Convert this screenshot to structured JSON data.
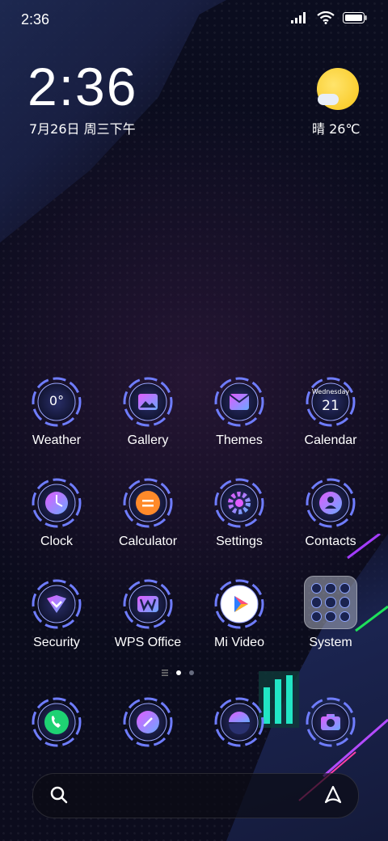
{
  "status_bar": {
    "time": "2:36"
  },
  "lockscreen_widget": {
    "clock": "2:36",
    "date": "7月26日 周三下午",
    "weather": "晴 26℃"
  },
  "apps": [
    {
      "label": "Weather",
      "icon": "weather-icon",
      "text": "0°"
    },
    {
      "label": "Gallery",
      "icon": "gallery-icon"
    },
    {
      "label": "Themes",
      "icon": "themes-icon"
    },
    {
      "label": "Calendar",
      "icon": "calendar-icon",
      "day": "Wednesday",
      "date": "21"
    },
    {
      "label": "Clock",
      "icon": "clock-icon"
    },
    {
      "label": "Calculator",
      "icon": "calculator-icon"
    },
    {
      "label": "Settings",
      "icon": "settings-icon"
    },
    {
      "label": "Contacts",
      "icon": "contacts-icon"
    },
    {
      "label": "Security",
      "icon": "security-icon"
    },
    {
      "label": "WPS Office",
      "icon": "wps-office-icon"
    },
    {
      "label": "Mi Video",
      "icon": "mi-video-icon"
    },
    {
      "label": "System",
      "icon": "system-folder"
    }
  ],
  "dock": [
    {
      "icon": "phone-icon"
    },
    {
      "icon": "browser-icon"
    },
    {
      "icon": "mi-store-icon"
    },
    {
      "icon": "camera-icon"
    }
  ],
  "colors": {
    "ring": "#6f7dff",
    "accent_pink": "#e05cff",
    "accent_green": "#1ed273",
    "accent_orange": "#ff8a2a"
  }
}
